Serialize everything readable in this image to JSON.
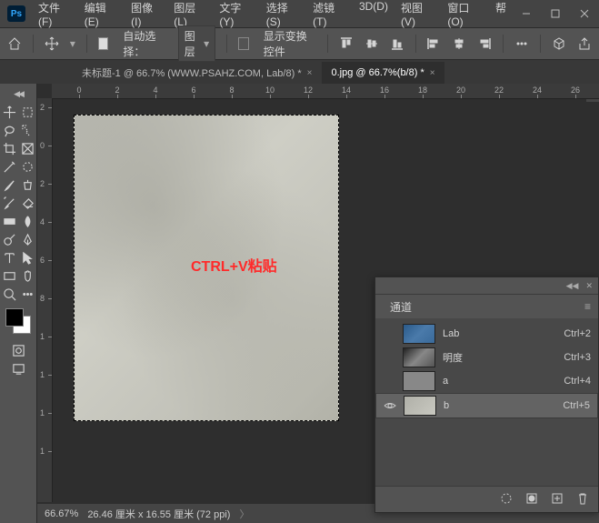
{
  "menu": {
    "file": "文件(F)",
    "edit": "编辑(E)",
    "image": "图像(I)",
    "layer": "图层(L)",
    "type": "文字(Y)",
    "select": "选择(S)",
    "filter": "滤镜(T)",
    "threeD": "3D(D)",
    "view": "视图(V)",
    "window": "窗口(O)",
    "help": "帮"
  },
  "optbar": {
    "auto_select": "自动选择：",
    "layer_dd": "图层",
    "show_transform": "显示变换控件"
  },
  "tabs": {
    "t1": "未标题-1 @ 66.7% (WWW.PSAHZ.COM, Lab/8) *",
    "t2": "0.jpg @ 66.7%(b/8) *"
  },
  "ruler_h": [
    "0",
    "2",
    "4",
    "6",
    "8",
    "10",
    "12",
    "14",
    "16",
    "18",
    "20",
    "22",
    "24",
    "26"
  ],
  "ruler_v": [
    "2",
    "0",
    "2",
    "4",
    "6",
    "8",
    "1",
    "1",
    "1",
    "1"
  ],
  "overlay": "CTRL+V粘贴",
  "status": {
    "zoom": "66.67%",
    "doc": "26.46 厘米 x 16.55 厘米 (72 ppi)"
  },
  "panel": {
    "title": "通道",
    "rows": [
      {
        "name": "Lab",
        "key": "Ctrl+2"
      },
      {
        "name": "明度",
        "key": "Ctrl+3"
      },
      {
        "name": "a",
        "key": "Ctrl+4"
      },
      {
        "name": "b",
        "key": "Ctrl+5"
      }
    ]
  }
}
